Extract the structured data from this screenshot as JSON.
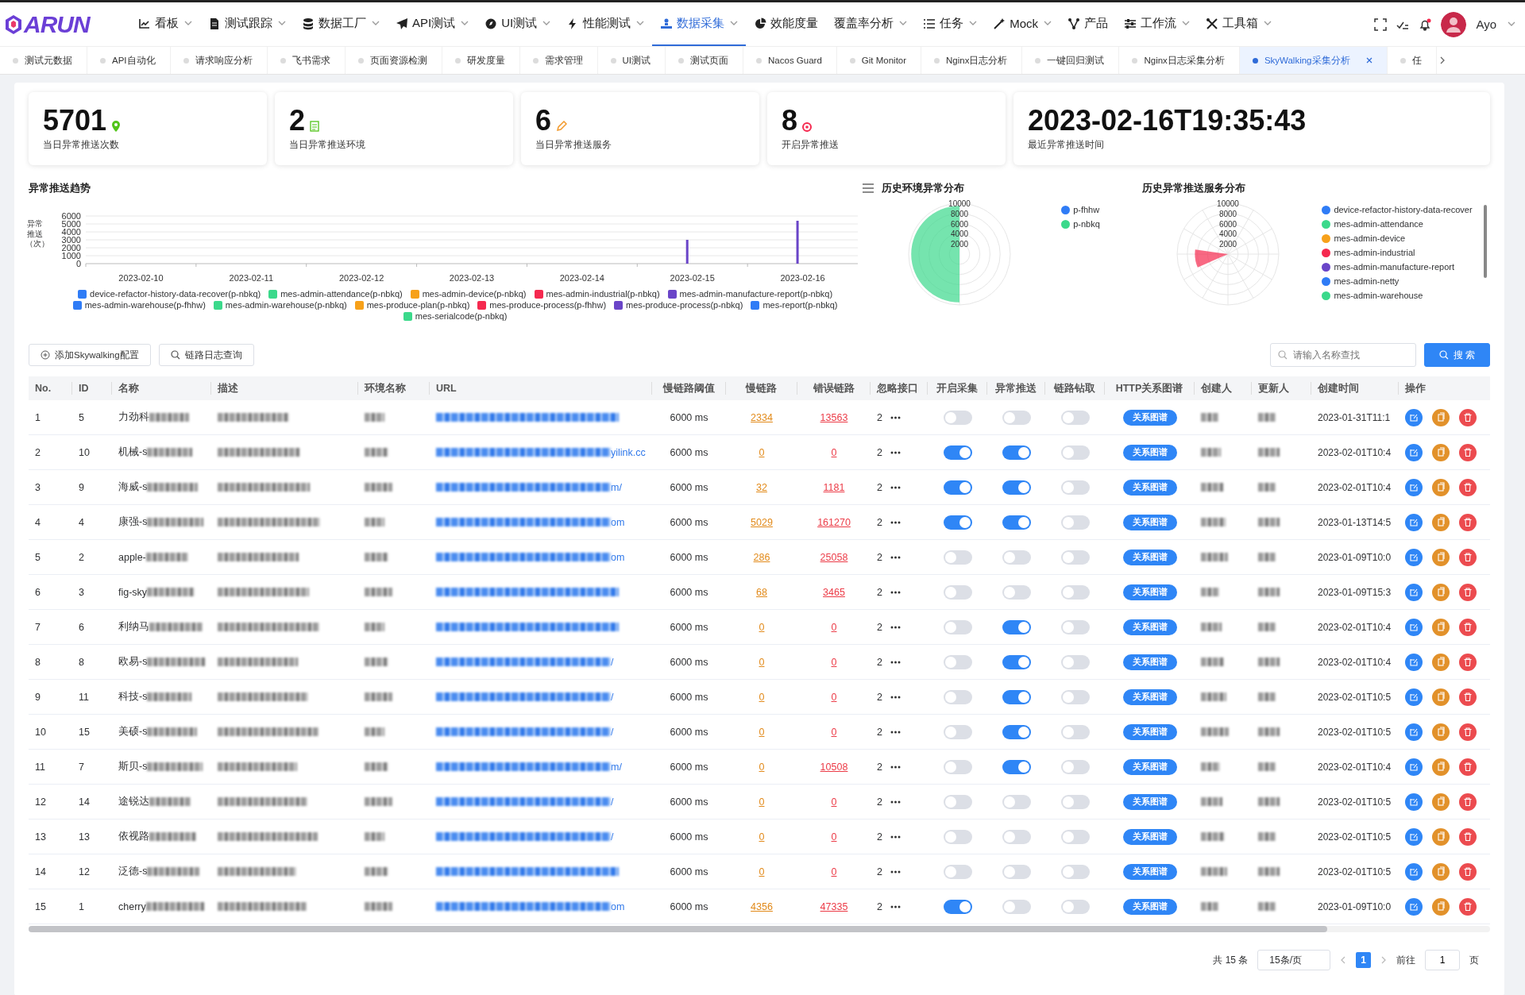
{
  "header": {
    "logo": "ARUN",
    "menu": [
      {
        "label": "看板",
        "caret": true,
        "selected": false
      },
      {
        "label": "测试跟踪",
        "caret": true,
        "selected": false
      },
      {
        "label": "数据工厂",
        "caret": true,
        "selected": false
      },
      {
        "label": "API测试",
        "caret": true,
        "selected": false
      },
      {
        "label": "UI测试",
        "caret": true,
        "selected": false
      },
      {
        "label": "性能测试",
        "caret": true,
        "selected": false
      },
      {
        "label": "数据采集",
        "caret": true,
        "selected": true
      },
      {
        "label": "效能度量",
        "caret": false,
        "selected": false
      },
      {
        "label": "覆盖率分析",
        "caret": true,
        "selected": false
      },
      {
        "label": "任务",
        "caret": true,
        "selected": false
      },
      {
        "label": "Mock",
        "caret": true,
        "selected": false
      },
      {
        "label": "产品",
        "caret": false,
        "selected": false
      },
      {
        "label": "工作流",
        "caret": true,
        "selected": false
      },
      {
        "label": "工具箱",
        "caret": true,
        "selected": false
      }
    ],
    "user": {
      "name": "Ayo",
      "notification_dot": true
    }
  },
  "tabs": [
    {
      "label": "测试元数据",
      "selected": false
    },
    {
      "label": "API自动化",
      "selected": false
    },
    {
      "label": "请求响应分析",
      "selected": false
    },
    {
      "label": "飞书需求",
      "selected": false
    },
    {
      "label": "页面资源检测",
      "selected": false
    },
    {
      "label": "研发度量",
      "selected": false
    },
    {
      "label": "需求管理",
      "selected": false
    },
    {
      "label": "UI测试",
      "selected": false
    },
    {
      "label": "测试页面",
      "selected": false
    },
    {
      "label": "Nacos Guard",
      "selected": false
    },
    {
      "label": "Git Monitor",
      "selected": false
    },
    {
      "label": "Nginx日志分析",
      "selected": false
    },
    {
      "label": "一键回归测试",
      "selected": false
    },
    {
      "label": "Nginx日志采集分析",
      "selected": false
    },
    {
      "label": "SkyWalking采集分析",
      "selected": true
    },
    {
      "label": "任",
      "selected": false
    }
  ],
  "stats": [
    {
      "value": "5701",
      "label": "当日异常推送次数"
    },
    {
      "value": "2",
      "label": "当日异常推送环境"
    },
    {
      "value": "6",
      "label": "当日异常推送服务"
    },
    {
      "value": "8",
      "label": "开启异常推送"
    },
    {
      "value": "2023-02-16T19:35:43",
      "label": "最近异常推送时间"
    }
  ],
  "trend": {
    "title": "异常推送趋势",
    "chart_data": {
      "type": "bar",
      "ylabel": "异常推送（次）",
      "grid": true,
      "categories": [
        "2023-02-10",
        "2023-02-11",
        "2023-02-12",
        "2023-02-13",
        "2023-02-14",
        "2023-02-15",
        "2023-02-16"
      ],
      "yticks": [
        0,
        1000,
        2000,
        3000,
        4000,
        5000,
        6000
      ],
      "ylim": [
        0,
        6000
      ],
      "series": [
        {
          "name": "device-refactor-history-data-recover(p-nbkq)",
          "color": "#2f7cf6",
          "values": [
            0,
            0,
            0,
            0,
            0,
            0,
            0
          ]
        },
        {
          "name": "mes-admin-attendance(p-nbkq)",
          "color": "#3bd98b",
          "values": [
            0,
            0,
            0,
            0,
            0,
            0,
            0
          ]
        },
        {
          "name": "mes-admin-device(p-nbkq)",
          "color": "#f7a11a",
          "values": [
            0,
            0,
            0,
            0,
            0,
            0,
            0
          ]
        },
        {
          "name": "mes-admin-industrial(p-nbkq)",
          "color": "#f5294f",
          "values": [
            0,
            0,
            0,
            0,
            0,
            0,
            0
          ]
        },
        {
          "name": "mes-admin-manufacture-report(p-nbkq)",
          "color": "#6a45c8",
          "values": [
            0,
            0,
            0,
            0,
            0,
            3000,
            5400
          ]
        },
        {
          "name": "mes-admin-warehouse(p-fhhw)",
          "color": "#2f7cf6",
          "values": [
            0,
            0,
            0,
            0,
            0,
            0,
            0
          ]
        },
        {
          "name": "mes-admin-warehouse(p-nbkq)",
          "color": "#3bd98b",
          "values": [
            0,
            0,
            0,
            0,
            0,
            0,
            0
          ]
        },
        {
          "name": "mes-produce-plan(p-nbkq)",
          "color": "#f7a11a",
          "values": [
            0,
            0,
            0,
            0,
            0,
            0,
            0
          ]
        },
        {
          "name": "mes-produce-process(p-fhhw)",
          "color": "#f5294f",
          "values": [
            0,
            0,
            0,
            0,
            0,
            0,
            0
          ]
        },
        {
          "name": "mes-produce-process(p-nbkq)",
          "color": "#6a45c8",
          "values": [
            0,
            0,
            0,
            0,
            0,
            0,
            0
          ]
        },
        {
          "name": "mes-report(p-nbkq)",
          "color": "#2f7cf6",
          "values": [
            0,
            0,
            0,
            0,
            0,
            0,
            0
          ]
        },
        {
          "name": "mes-serialcode(p-nbkq)",
          "color": "#3bd98b",
          "values": [
            0,
            0,
            0,
            0,
            0,
            0,
            0
          ]
        }
      ]
    }
  },
  "env_distribution": {
    "title": "历史环境异常分布",
    "scale_labels": [
      "10000",
      "8000",
      "6000",
      "4000",
      "2000"
    ],
    "legend": [
      {
        "label": "p-fhhw",
        "color": "#2f7cf6"
      },
      {
        "label": "p-nbkq",
        "color": "#3bd98b"
      }
    ]
  },
  "service_distribution": {
    "title": "历史异常推送服务分布",
    "scale_labels": [
      "10000",
      "8000",
      "6000",
      "4000",
      "2000"
    ],
    "legend": [
      {
        "label": "device-refactor-history-data-recover",
        "color": "#2f7cf6"
      },
      {
        "label": "mes-admin-attendance",
        "color": "#3bd98b"
      },
      {
        "label": "mes-admin-device",
        "color": "#f7a11a"
      },
      {
        "label": "mes-admin-industrial",
        "color": "#f5294f"
      },
      {
        "label": "mes-admin-manufacture-report",
        "color": "#6a45c8"
      },
      {
        "label": "mes-admin-netty",
        "color": "#2f7cf6"
      },
      {
        "label": "mes-admin-warehouse",
        "color": "#3bd98b"
      }
    ]
  },
  "toolbar": {
    "add_button": "添加Skywalking配置",
    "log_button": "链路日志查询",
    "search": {
      "placeholder": "请输入名称查找"
    },
    "search_button": "搜 索"
  },
  "table": {
    "columns": [
      "No.",
      "ID",
      "名称",
      "描述",
      "环境名称",
      "URL",
      "慢链路阈值",
      "慢链路",
      "错误链路",
      "忽略接口",
      "开启采集",
      "异常推送",
      "链路钻取",
      "HTTP关系图谱",
      "创建人",
      "更新人",
      "创建时间",
      "操作"
    ],
    "rows": [
      {
        "no": "1",
        "id": "5",
        "name": "力劲科",
        "url": "",
        "threshold": "6000 ms",
        "slow": "2334",
        "error": "13563",
        "ignore": "2",
        "collect": false,
        "push": false,
        "drill": false,
        "graph": "关系图谱",
        "created": "2023-01-31T11:1"
      },
      {
        "no": "2",
        "id": "10",
        "name": "机械-s",
        "url": "yilink.cc",
        "threshold": "6000 ms",
        "slow": "0",
        "error": "0",
        "ignore": "2",
        "collect": true,
        "push": true,
        "drill": false,
        "graph": "关系图谱",
        "created": "2023-02-01T10:4"
      },
      {
        "no": "3",
        "id": "9",
        "name": "海威-s",
        "url": "m/",
        "threshold": "6000 ms",
        "slow": "32",
        "error": "1181",
        "ignore": "2",
        "collect": true,
        "push": true,
        "drill": false,
        "graph": "关系图谱",
        "created": "2023-02-01T10:4"
      },
      {
        "no": "4",
        "id": "4",
        "name": "康强-s",
        "url": "om",
        "threshold": "6000 ms",
        "slow": "5029",
        "error": "161270",
        "ignore": "2",
        "collect": true,
        "push": true,
        "drill": false,
        "graph": "关系图谱",
        "created": "2023-01-13T14:5"
      },
      {
        "no": "5",
        "id": "2",
        "name": "apple-",
        "url": "om",
        "threshold": "6000 ms",
        "slow": "286",
        "error": "25058",
        "ignore": "2",
        "collect": false,
        "push": false,
        "drill": false,
        "graph": "关系图谱",
        "created": "2023-01-09T10:0"
      },
      {
        "no": "6",
        "id": "3",
        "name": "fig-sky",
        "url": "",
        "threshold": "6000 ms",
        "slow": "68",
        "error": "3465",
        "ignore": "2",
        "collect": false,
        "push": false,
        "drill": false,
        "graph": "关系图谱",
        "created": "2023-01-09T15:3"
      },
      {
        "no": "7",
        "id": "6",
        "name": "利纳马",
        "url": "",
        "threshold": "6000 ms",
        "slow": "0",
        "error": "0",
        "ignore": "2",
        "collect": false,
        "push": true,
        "drill": false,
        "graph": "关系图谱",
        "created": "2023-02-01T10:4"
      },
      {
        "no": "8",
        "id": "8",
        "name": "欧易-s",
        "url": "/",
        "threshold": "6000 ms",
        "slow": "0",
        "error": "0",
        "ignore": "2",
        "collect": false,
        "push": true,
        "drill": false,
        "graph": "关系图谱",
        "created": "2023-02-01T10:4"
      },
      {
        "no": "9",
        "id": "11",
        "name": "科技-s",
        "url": "/",
        "threshold": "6000 ms",
        "slow": "0",
        "error": "0",
        "ignore": "2",
        "collect": false,
        "push": true,
        "drill": false,
        "graph": "关系图谱",
        "created": "2023-02-01T10:5"
      },
      {
        "no": "10",
        "id": "15",
        "name": "美硕-s",
        "url": "/",
        "threshold": "6000 ms",
        "slow": "0",
        "error": "0",
        "ignore": "2",
        "collect": false,
        "push": true,
        "drill": false,
        "graph": "关系图谱",
        "created": "2023-02-01T10:5"
      },
      {
        "no": "11",
        "id": "7",
        "name": "斯贝-s",
        "url": "m/",
        "threshold": "6000 ms",
        "slow": "0",
        "error": "10508",
        "ignore": "2",
        "collect": false,
        "push": true,
        "drill": false,
        "graph": "关系图谱",
        "created": "2023-02-01T10:4"
      },
      {
        "no": "12",
        "id": "14",
        "name": "途锐达",
        "url": "/",
        "threshold": "6000 ms",
        "slow": "0",
        "error": "0",
        "ignore": "2",
        "collect": false,
        "push": false,
        "drill": false,
        "graph": "关系图谱",
        "created": "2023-02-01T10:5"
      },
      {
        "no": "13",
        "id": "13",
        "name": "依视路",
        "url": "/",
        "threshold": "6000 ms",
        "slow": "0",
        "error": "0",
        "ignore": "2",
        "collect": false,
        "push": false,
        "drill": false,
        "graph": "关系图谱",
        "created": "2023-02-01T10:5"
      },
      {
        "no": "14",
        "id": "12",
        "name": "泛德-s",
        "url": "",
        "threshold": "6000 ms",
        "slow": "0",
        "error": "0",
        "ignore": "2",
        "collect": false,
        "push": false,
        "drill": false,
        "graph": "关系图谱",
        "created": "2023-02-01T10:5"
      },
      {
        "no": "15",
        "id": "1",
        "name": "cherry",
        "url": "om",
        "threshold": "6000 ms",
        "slow": "4356",
        "error": "47335",
        "ignore": "2",
        "collect": true,
        "push": false,
        "drill": false,
        "graph": "关系图谱",
        "created": "2023-01-09T10:0"
      }
    ]
  },
  "pagination": {
    "total": "共 15 条",
    "page_size": "15条/页",
    "pages": [
      {
        "label": "1",
        "selected": true
      }
    ],
    "goto_label": "前往",
    "goto_value": "1",
    "page_suffix": "页"
  }
}
